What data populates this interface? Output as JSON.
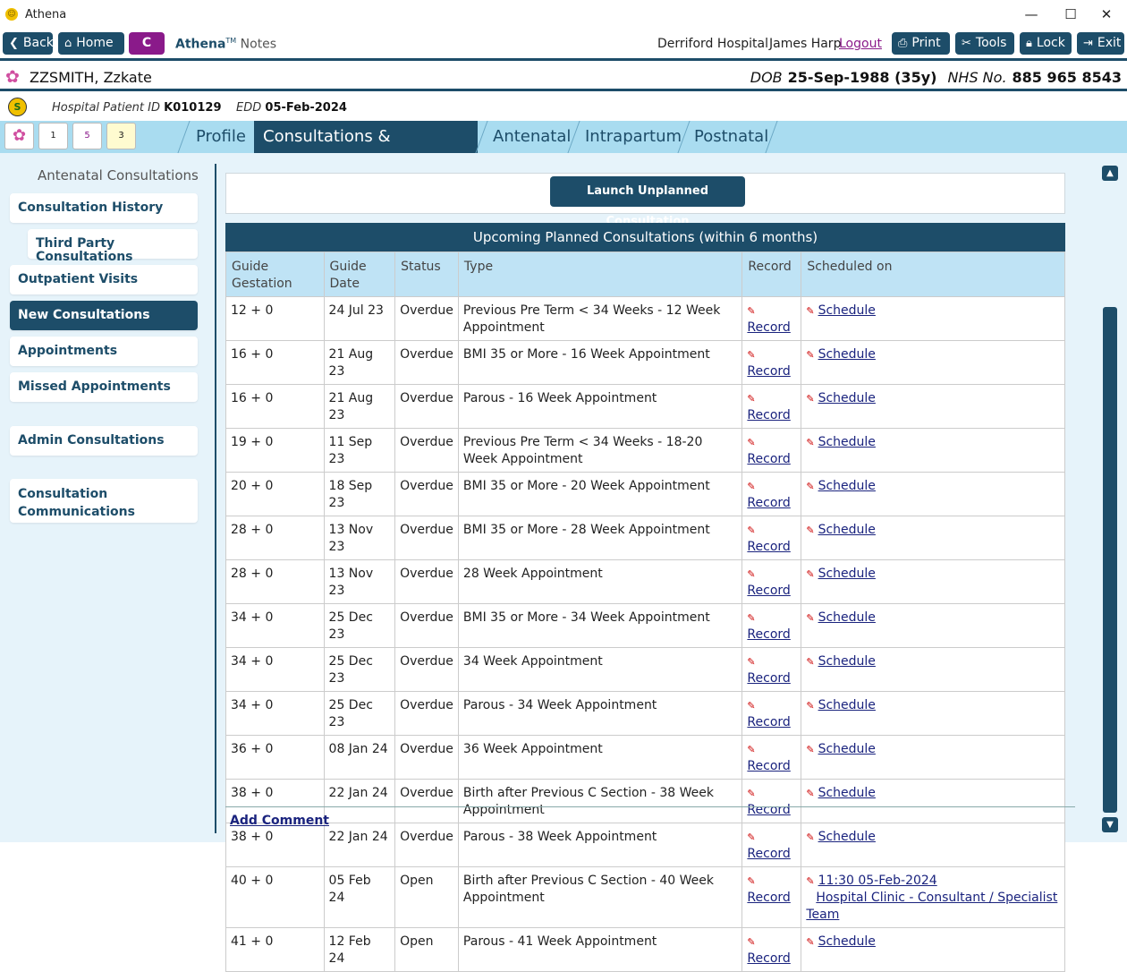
{
  "window": {
    "title": "Athena",
    "minimize": "—",
    "maximize": "☐",
    "close": "✕"
  },
  "toolbar": {
    "back": "Back",
    "home": "Home",
    "c_button": "C",
    "brand": "Athena",
    "brand_tm": "TM",
    "brand_suffix": "Notes",
    "hospital": "Derriford Hospital",
    "user": "James Harp",
    "logout": "Logout",
    "print": "Print",
    "tools": "Tools",
    "lock": "Lock",
    "exit": "Exit"
  },
  "patient": {
    "name": "ZZSMITH, Zzkate",
    "dob_label": "DOB",
    "dob": "25-Sep-1988 (35y)",
    "nhs_label": "NHS No.",
    "nhs": "885 965 8543",
    "hospital_id_label": "Hospital Patient ID",
    "hospital_id": "K010129",
    "edd_label": "EDD",
    "edd": "05-Feb-2024"
  },
  "quick_icons": {
    "meds_count": "1",
    "alerts_count": "5",
    "notes_count": "3"
  },
  "tabs": [
    {
      "label": "Profile"
    },
    {
      "label": "Consultations & Admissions"
    },
    {
      "label": "Antenatal"
    },
    {
      "label": "Intrapartum"
    },
    {
      "label": "Postnatal"
    }
  ],
  "sidebar": {
    "title": "Antenatal Consultations",
    "items": [
      {
        "label": "Consultation History"
      },
      {
        "label": "Third Party Consultations"
      },
      {
        "label": "Outpatient Visits"
      },
      {
        "label": "New Consultations"
      },
      {
        "label": "Appointments"
      },
      {
        "label": "Missed Appointments"
      },
      {
        "label": "Admin Consultations"
      },
      {
        "label": "Consultation Communications"
      }
    ]
  },
  "launch_button": "Launch Unplanned Consultation",
  "table": {
    "title": "Upcoming Planned Consultations (within 6 months)",
    "columns": [
      "Guide Gestation",
      "Guide Date",
      "Status",
      "Type",
      "Record",
      "Scheduled on"
    ],
    "rows": [
      {
        "gestation": "12 + 0",
        "date": "24 Jul 23",
        "status": "Overdue",
        "type": "Previous Pre Term < 34 Weeks - 12 Week Appointment",
        "record": "Record",
        "schedule": "Schedule"
      },
      {
        "gestation": "16 + 0",
        "date": "21 Aug 23",
        "status": "Overdue",
        "type": "BMI 35 or More - 16 Week Appointment",
        "record": "Record",
        "schedule": "Schedule"
      },
      {
        "gestation": "16 + 0",
        "date": "21 Aug 23",
        "status": "Overdue",
        "type": "Parous - 16 Week Appointment",
        "record": "Record",
        "schedule": "Schedule"
      },
      {
        "gestation": "19 + 0",
        "date": "11 Sep 23",
        "status": "Overdue",
        "type": "Previous Pre Term < 34 Weeks - 18-20 Week Appointment",
        "record": "Record",
        "schedule": "Schedule"
      },
      {
        "gestation": "20 + 0",
        "date": "18 Sep 23",
        "status": "Overdue",
        "type": "BMI 35 or More - 20 Week Appointment",
        "record": "Record",
        "schedule": "Schedule"
      },
      {
        "gestation": "28 + 0",
        "date": "13 Nov 23",
        "status": "Overdue",
        "type": "BMI 35 or More - 28 Week Appointment",
        "record": "Record",
        "schedule": "Schedule"
      },
      {
        "gestation": "28 + 0",
        "date": "13 Nov 23",
        "status": "Overdue",
        "type": "28 Week Appointment",
        "record": "Record",
        "schedule": "Schedule"
      },
      {
        "gestation": "34 + 0",
        "date": "25 Dec 23",
        "status": "Overdue",
        "type": "BMI 35 or More - 34 Week Appointment",
        "record": "Record",
        "schedule": "Schedule"
      },
      {
        "gestation": "34 + 0",
        "date": "25 Dec 23",
        "status": "Overdue",
        "type": "34 Week Appointment",
        "record": "Record",
        "schedule": "Schedule"
      },
      {
        "gestation": "34 + 0",
        "date": "25 Dec 23",
        "status": "Overdue",
        "type": "Parous - 34 Week Appointment",
        "record": "Record",
        "schedule": "Schedule"
      },
      {
        "gestation": "36 + 0",
        "date": "08 Jan 24",
        "status": "Overdue",
        "type": "36 Week Appointment",
        "record": "Record",
        "schedule": "Schedule"
      },
      {
        "gestation": "38 + 0",
        "date": "22 Jan 24",
        "status": "Overdue",
        "type": "Birth after Previous C Section - 38 Week Appointment",
        "record": "Record",
        "schedule": "Schedule"
      },
      {
        "gestation": "38 + 0",
        "date": "22 Jan 24",
        "status": "Overdue",
        "type": "Parous - 38 Week Appointment",
        "record": "Record",
        "schedule": "Schedule"
      },
      {
        "gestation": "40 + 0",
        "date": "05 Feb 24",
        "status": "Open",
        "type": "Birth after Previous C Section - 40 Week Appointment",
        "record": "Record",
        "schedule": "11:30 05-Feb-2024",
        "schedule_line2": "Hospital Clinic - Consultant / Specialist Team"
      },
      {
        "gestation": "41 + 0",
        "date": "12 Feb 24",
        "status": "Open",
        "type": "Parous - 41 Week Appointment",
        "record": "Record",
        "schedule": "Schedule"
      }
    ]
  },
  "add_comment": "Add Comment",
  "colors": {
    "primary": "#1d4d69",
    "accent": "#8a1a8a",
    "tab_bg": "#a9dcf0",
    "panel_bg": "#e6f3fa",
    "header_bg": "#bfe3f5"
  }
}
